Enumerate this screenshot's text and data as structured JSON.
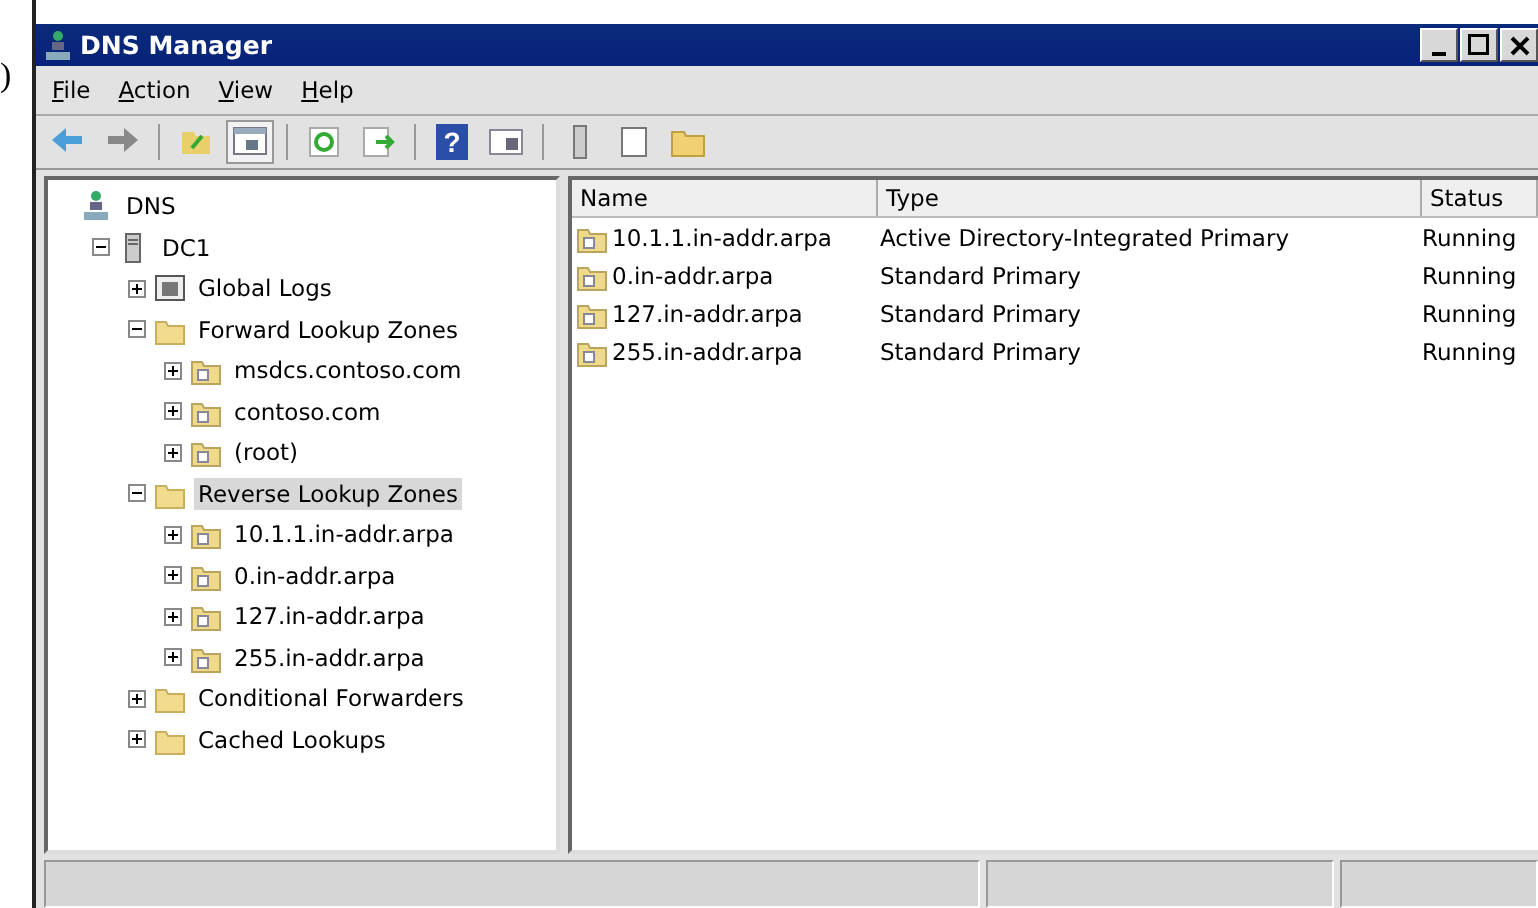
{
  "page_fragment": ")",
  "window": {
    "title": "DNS Manager"
  },
  "menu": [
    {
      "label": "File"
    },
    {
      "label": "Action"
    },
    {
      "label": "View"
    },
    {
      "label": "Help"
    }
  ],
  "toolbar": [
    {
      "kind": "back"
    },
    {
      "kind": "forward"
    },
    {
      "kind": "sep"
    },
    {
      "kind": "up"
    },
    {
      "kind": "pane",
      "selected": true
    },
    {
      "kind": "sep"
    },
    {
      "kind": "refresh"
    },
    {
      "kind": "export"
    },
    {
      "kind": "sep"
    },
    {
      "kind": "help",
      "label": "?"
    },
    {
      "kind": "pane2"
    },
    {
      "kind": "sep"
    },
    {
      "kind": "server"
    },
    {
      "kind": "page"
    },
    {
      "kind": "folder"
    }
  ],
  "tree": [
    {
      "label": "DNS",
      "kind": "dns",
      "selected": false,
      "children": [
        {
          "label": "DC1",
          "kind": "server",
          "expanded": true,
          "selected": false,
          "children": [
            {
              "label": "Global Logs",
              "kind": "logs",
              "expanded": false,
              "selected": false
            },
            {
              "label": "Forward Lookup Zones",
              "kind": "folder",
              "expanded": true,
              "selected": false,
              "children": [
                {
                  "label": "msdcs.contoso.com",
                  "kind": "zone",
                  "expanded": false,
                  "selected": false
                },
                {
                  "label": "contoso.com",
                  "kind": "zone",
                  "expanded": false,
                  "selected": false
                },
                {
                  "label": "(root)",
                  "kind": "zone",
                  "expanded": false,
                  "selected": false
                }
              ]
            },
            {
              "label": "Reverse Lookup Zones",
              "kind": "folder",
              "expanded": true,
              "selected": true,
              "children": [
                {
                  "label": "10.1.1.in-addr.arpa",
                  "kind": "zone",
                  "expanded": false,
                  "selected": false
                },
                {
                  "label": "0.in-addr.arpa",
                  "kind": "zone",
                  "expanded": false,
                  "selected": false
                },
                {
                  "label": "127.in-addr.arpa",
                  "kind": "zone",
                  "expanded": false,
                  "selected": false
                },
                {
                  "label": "255.in-addr.arpa",
                  "kind": "zone",
                  "expanded": false,
                  "selected": false
                }
              ]
            },
            {
              "label": "Conditional Forwarders",
              "kind": "folder",
              "expanded": false,
              "selected": false
            },
            {
              "label": "Cached Lookups",
              "kind": "folder",
              "expanded": false,
              "selected": false
            }
          ]
        }
      ]
    }
  ],
  "table": {
    "columns": [
      "Name",
      "Type",
      "Status"
    ],
    "rows": [
      {
        "name": "10.1.1.in-addr.arpa",
        "type": "Active Directory-Integrated Primary",
        "status": "Running"
      },
      {
        "name": "0.in-addr.arpa",
        "type": "Standard Primary",
        "status": "Running"
      },
      {
        "name": "127.in-addr.arpa",
        "type": "Standard Primary",
        "status": "Running"
      },
      {
        "name": "255.in-addr.arpa",
        "type": "Standard Primary",
        "status": "Running"
      }
    ]
  }
}
